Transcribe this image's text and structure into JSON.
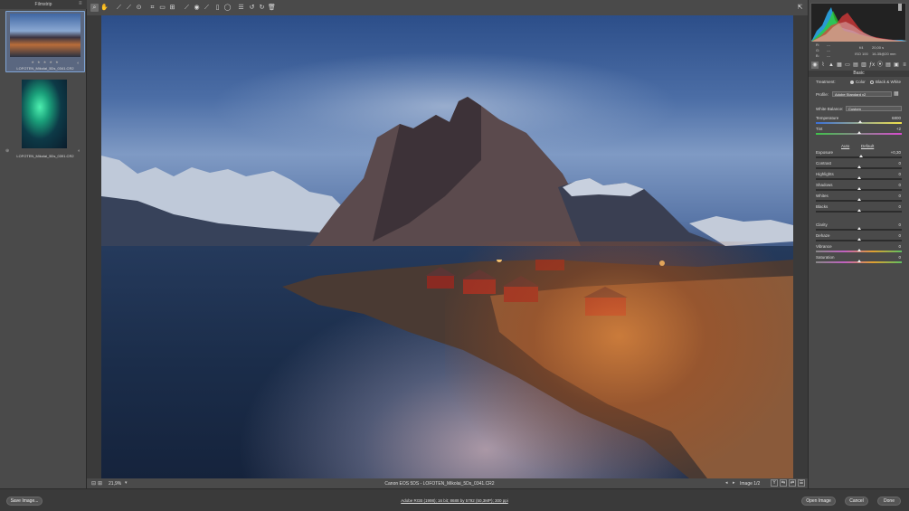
{
  "filmstrip": {
    "title": "Filmstrip",
    "menu_icon": "menu-icon",
    "items": [
      {
        "filename": "LOFOTEN_Mikolai_5Ds_0341.CR2",
        "rating": "★ ★ ★ ★ ★",
        "selected": true
      },
      {
        "filename": "LOFOTEN_Mikolai_5Ds_0391.CR2",
        "selected": false
      }
    ]
  },
  "toolbar": {
    "tools": [
      "zoom-icon",
      "hand-icon",
      "white-balance-icon",
      "color-sampler-icon",
      "target-adjust-icon",
      "crop-icon",
      "straighten-icon",
      "transform-icon",
      "spot-removal-icon",
      "red-eye-icon",
      "adjustment-brush-icon",
      "graduated-filter-icon",
      "radial-filter-icon",
      "preferences-icon",
      "rotate-ccw-icon",
      "rotate-cw-icon",
      "trash-icon"
    ],
    "fullscreen_icon": "fullscreen-icon"
  },
  "image_footer": {
    "zoom": "21,9%",
    "camera_caption": "Canon EOS 5DS  -  LOFOTEN_Mikolai_5Ds_0341.CR2",
    "image_counter": "Image 1/2"
  },
  "status_bar": {
    "save_label": "Save Image...",
    "workflow_link": "Adobe RGB (1998); 16 bit; 8688 by 5792 (50,3MP); 300 ppi",
    "open_label": "Open Image",
    "cancel_label": "Cancel",
    "done_label": "Done"
  },
  "histogram": {
    "r_label": "R:",
    "g_label": "G:",
    "b_label": "B:",
    "r": "---",
    "g": "---",
    "b": "---",
    "aperture": "f/4",
    "shutter": "20,00 s",
    "iso": "ISO 100",
    "lens": "16-35@20 mm"
  },
  "basic_panel": {
    "title": "Basic",
    "treatment_label": "Treatment:",
    "color_label": "Color",
    "bw_label": "Black & White",
    "profile_label": "Profile:",
    "profile_value": "Adobe Standard v2",
    "wb_label": "White Balance:",
    "wb_value": "Custom",
    "auto_label": "Auto",
    "default_label": "Default",
    "sliders": [
      {
        "name": "Temperature",
        "value": "6800",
        "level": 0.52
      },
      {
        "name": "Tint",
        "value": "+2",
        "level": 0.51
      },
      {
        "name": "Exposure",
        "value": "+0,30",
        "level": 0.53
      },
      {
        "name": "Contrast",
        "value": "0",
        "level": 0.5
      },
      {
        "name": "Highlights",
        "value": "0",
        "level": 0.5
      },
      {
        "name": "Shadows",
        "value": "0",
        "level": 0.5
      },
      {
        "name": "Whites",
        "value": "0",
        "level": 0.5
      },
      {
        "name": "Blacks",
        "value": "0",
        "level": 0.5
      },
      {
        "name": "Clarity",
        "value": "0",
        "level": 0.5
      },
      {
        "name": "Dehaze",
        "value": "0",
        "level": 0.5
      },
      {
        "name": "Vibrance",
        "value": "0",
        "level": 0.5
      },
      {
        "name": "Saturation",
        "value": "0",
        "level": 0.5
      }
    ]
  },
  "colors": {
    "selection_border": "#7fa5d6",
    "panel_bg": "#4a4a4a",
    "accent_sunset": "#e98a3b"
  }
}
